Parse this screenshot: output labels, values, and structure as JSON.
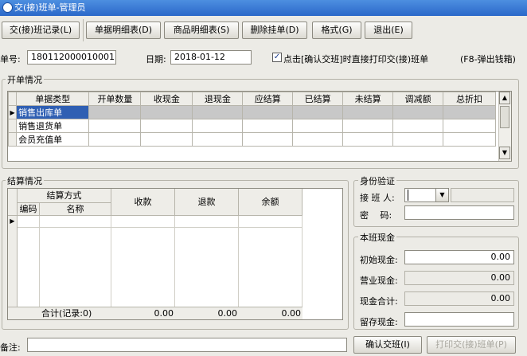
{
  "window": {
    "title": "交(接)班单-管理员"
  },
  "toolbar": {
    "handover_record": "交(接)班记录(L)",
    "doc_detail": "单据明细表(D)",
    "goods_detail": "商品明细表(S)",
    "delete_pending": "删除挂单(D)",
    "format": "格式(G)",
    "exit": "退出(E)"
  },
  "header": {
    "doc_no_label": "单号:",
    "doc_no": "180112000010001",
    "date_label": "日期:",
    "date": "2018-01-12",
    "print_checkbox_label": "点击[确认交班]时直接打印交(接)班单",
    "print_checked": true,
    "hint": "(F8-弹出钱箱)"
  },
  "order_section": {
    "title": "开单情况",
    "columns": [
      "单据类型",
      "开单数量",
      "收现金",
      "退现金",
      "应结算",
      "已结算",
      "未结算",
      "调减额",
      "总折扣"
    ],
    "rows": [
      {
        "type": "销售出库单"
      },
      {
        "type": "销售退货单"
      },
      {
        "type": "会员充值单"
      }
    ]
  },
  "settle_section": {
    "title": "结算情况",
    "group_header": "结算方式",
    "code_header": "编码",
    "name_header": "名称",
    "receipt_header": "收款",
    "refund_header": "退款",
    "balance_header": "余额",
    "total_label": "合计(记录:0)",
    "total_receipt": "0.00",
    "total_refund": "0.00",
    "total_balance": "0.00"
  },
  "identity": {
    "title": "身份验证",
    "receiver_label": "接 班 人:",
    "password_label": "密　 码:"
  },
  "cash": {
    "title": "本班现金",
    "initial_label": "初始现金:",
    "initial": "0.00",
    "business_label": "营业现金:",
    "business": "0.00",
    "total_label": "现金合计:",
    "total": "0.00",
    "retained_label": "留存现金:"
  },
  "footer": {
    "remark_label": "备注:",
    "confirm_button": "确认交班(I)",
    "print_button": "打印交(接)班单(P)"
  },
  "colors": {
    "title_bar": "#2b68c9",
    "selected_row": "#2f5fb3",
    "window_bg": "#ecebe6"
  }
}
